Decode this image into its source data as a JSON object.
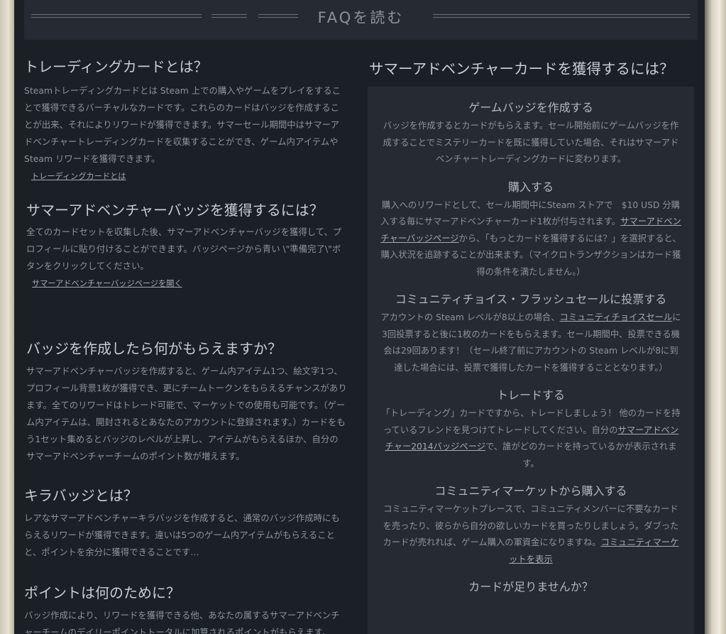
{
  "header": {
    "title": "FAQを読む"
  },
  "left": [
    {
      "heading": "トレーディングカードとは？",
      "body": "Steamトレーディングカードとは Steam 上での購入やゲームをプレイをすることで獲得できるバーチャルなカードです。これらのカードはバッジを作成することが出来、それによりリワードが獲得できます。サマーセール期間中はサマーアドベンチャートレーディングカードを収集することができ、ゲーム内アイテムや Steam リワードを獲得できます。",
      "link": "トレーディングカードとは"
    },
    {
      "heading": "サマーアドベンチャーバッジを獲得するには？",
      "body": "全てのカードセットを収集した後、サマーアドベンチャーバッジを獲得して、プロフィールに貼り付けることができます。バッジページから青い \\\"準備完了\\\"ボタンをクリックしてください。",
      "link": "サマーアドベンチャーバッジページを開く"
    },
    {
      "heading": "バッジを作成したら何がもらえますか？",
      "body": "サマーアドベンチャーバッジを作成すると、ゲーム内アイテム1つ、絵文字1つ、プロフィール背景1枚が獲得でき、更にチームトークンをもらえるチャンスがあります。全てのリワードはトレード可能で、マーケットでの使用も可能です。（ゲーム内アイテムは、開封されるとあなたのアカウントに登録されます。）カードをもう1セット集めるとバッジのレベルが上昇し、アイテムがもらえるほか、自分のサマーアドベンチャーチームのポイント数が増えます。",
      "link": ""
    },
    {
      "heading": "キラバッジとは？",
      "body": "レアなサマーアドベンチャーキラバッジを作成すると、通常のバッジ作成時にもらえるリワードが獲得できます。違いは5つのゲーム内アイテムがもらえることと、ポイントを余分に獲得できることです…",
      "link": ""
    },
    {
      "heading": "ポイントは何のために？",
      "body": "バッジ作成により、リワードを獲得できる他、あなたの属するサマーアドベンチャーチームのデイリーポイントトータルに加算されるポイントがもらえます。",
      "link": ""
    }
  ],
  "right": {
    "heading": "サマーアドベンチャーカードを獲得するには？",
    "items": [
      {
        "title": "ゲームバッジを作成する",
        "text_a": "バッジを作成するとカードがもらえます。セール開始前にゲームバッジを作成することでミステリーカードを既に獲得していた場合、それはサマーアドベンチャートレーディングカードに変わります。",
        "link": "",
        "text_b": ""
      },
      {
        "title": "購入する",
        "text_a": "購入へのリワードとして、セール期間中にSteam ストアで　$10 USD 分購入する毎にサマーアドベンチャーカード1枚が付与されます。",
        "link": "サマーアドベンチャーバッジページ",
        "text_b": "から、「もっとカードを獲得するには？」を選択すると、購入状況を追跡することが出来ます。（マイクロトランザクションはカード獲得の条件を満たしません。）"
      },
      {
        "title": "コミュニティチョイス・フラッシュセールに投票する",
        "text_a": "アカウントの Steam レベルが8以上の場合、",
        "link": "コミュニティチョイスセール",
        "text_b": "に3回投票すると後に1枚のカードをもらえます。セール期間中、投票できる機会は29回あります！（セール終了前にアカウントの Steam レベルが8に到達した場合には、投票で獲得したカードを獲得することとなります。）"
      },
      {
        "title": "トレードする",
        "text_a": "「トレーディング」カードですから、トレードしましょう！ 他のカードを持っているフレンドを見つけてトレードしてください。自分の",
        "link": "サマーアドベンチャー2014バッジページ",
        "text_b": "で、誰がどのカードを持っているかが表示されます。"
      },
      {
        "title": "コミュニティマーケットから購入する",
        "text_a": "コミュニティマーケットプレースで、コミュニティメンバーに不要なカードを売ったり、彼らから自分の欲しいカードを買ったりしましょう。ダブったカードが売れれば、ゲーム購入の軍資金になりますね。",
        "link": "コミュニティマーケットを表示",
        "text_b": ""
      },
      {
        "title": "カードが足りませんか？",
        "text_a": "",
        "link": "",
        "text_b": ""
      }
    ]
  }
}
